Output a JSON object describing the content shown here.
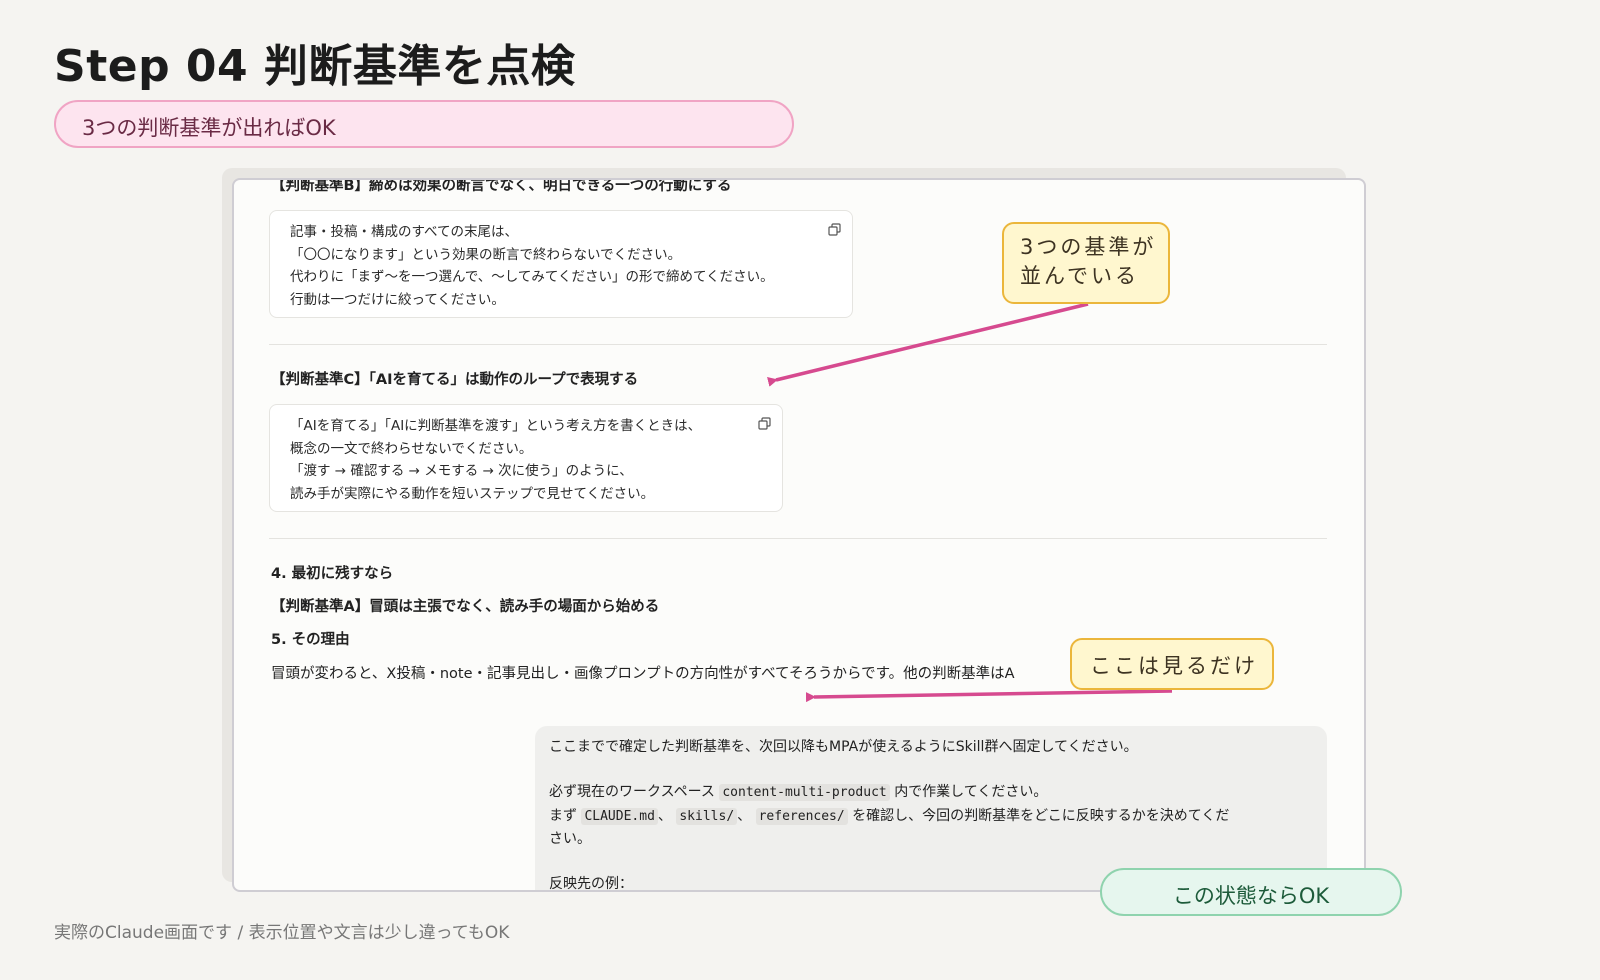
{
  "page": {
    "title": "Step 04  判断基準を点検",
    "subtitle": "3つの判断基準が出ればOK",
    "footnote": "実際のClaude画面です / 表示位置や文言は少し違ってもOK",
    "ok_badge": "この状態ならOK"
  },
  "screenshot": {
    "criterion_b_title": "【判断基準B】締めは効果の断言でなく、明日できる一つの行動にする",
    "criterion_b_lines": [
      "記事・投稿・構成のすべての末尾は、",
      "「〇〇になります」という効果の断言で終わらないでください。",
      "代わりに「まず〜を一つ選んで、〜してみてください」の形で締めてください。",
      "行動は一つだけに絞ってください。"
    ],
    "criterion_c_title": "【判断基準C】「AIを育てる」は動作のループで表現する",
    "criterion_c_lines": [
      "「AIを育てる」「AIに判断基準を渡す」という考え方を書くときは、",
      "概念の一文で終わらせないでください。",
      "「渡す → 確認する → メモする → 次に使う」のように、",
      "読み手が実際にやる動作を短いステップで見せてください。"
    ],
    "item4_title": "4. 最初に残すなら",
    "item4_body": "【判断基準A】冒頭は主張でなく、読み手の場面から始める",
    "item5_title": "5. その理由",
    "item5_body": "冒頭が変わると、X投稿・note・記事見出し・画像プロンプトの方向性がすべてそろうからです。他の判断基準はA",
    "user_message": {
      "line1": "ここまでで確定した判断基準を、次回以降もMPAが使えるようにSkill群へ固定してください。",
      "line2_pre": "必ず現在のワークスペース",
      "line2_code": "content-multi-product",
      "line2_post": "内で作業してください。",
      "line3_pre": "まず",
      "line3_code1": "CLAUDE.md",
      "line3_sep1": "、",
      "line3_code2": "skills/",
      "line3_sep2": "、",
      "line3_code3": "references/",
      "line3_post": "を確認し、今回の判断基準をどこに反映するかを決めてくだ",
      "line4": "さい。",
      "line5": "反映先の例："
    }
  },
  "callouts": {
    "criteria_line1": "3つの基準が",
    "criteria_line2": "並んでいる",
    "look_only": "ここは見るだけ"
  },
  "colors": {
    "arrow": "#d64a8f",
    "callout_border": "#ebb63b",
    "subtitle_pill": "#fde4ef",
    "ok_pill": "#e6f6ee"
  }
}
